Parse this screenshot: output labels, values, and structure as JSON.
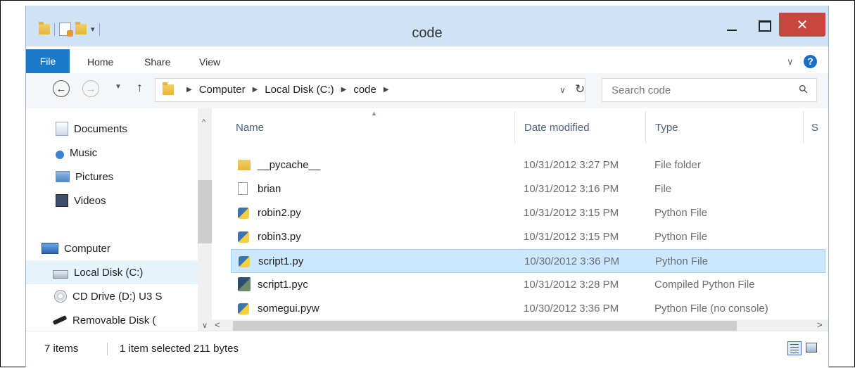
{
  "window": {
    "title": "code",
    "close_glyph": "✕"
  },
  "ribbon": {
    "file_label": "File",
    "tabs": [
      "Home",
      "Share",
      "View"
    ]
  },
  "address": {
    "crumbs": [
      "Computer",
      "Local Disk (C:)",
      "code"
    ],
    "search_placeholder": "Search code"
  },
  "nav": {
    "items": [
      {
        "label": "Documents",
        "icon": "documents-icon"
      },
      {
        "label": "Music",
        "icon": "music-icon"
      },
      {
        "label": "Pictures",
        "icon": "pictures-icon"
      },
      {
        "label": "Videos",
        "icon": "videos-icon"
      },
      {
        "label": "Computer",
        "icon": "computer-icon"
      },
      {
        "label": "Local Disk (C:)",
        "icon": "disk-icon",
        "selected": true
      },
      {
        "label": "CD Drive (D:) U3 S",
        "icon": "cd-drive-icon"
      },
      {
        "label": "Removable Disk (",
        "icon": "usb-icon"
      }
    ]
  },
  "list": {
    "columns": [
      "Name",
      "Date modified",
      "Type",
      "S"
    ],
    "rows": [
      {
        "name": "__pycache__",
        "date": "10/31/2012 3:27 PM",
        "type": "File folder",
        "icon": "folder-icon"
      },
      {
        "name": "brian",
        "date": "10/31/2012 3:16 PM",
        "type": "File",
        "icon": "file-icon"
      },
      {
        "name": "robin2.py",
        "date": "10/31/2012 3:15 PM",
        "type": "Python File",
        "icon": "python-file-icon"
      },
      {
        "name": "robin3.py",
        "date": "10/31/2012 3:15 PM",
        "type": "Python File",
        "icon": "python-file-icon"
      },
      {
        "name": "script1.py",
        "date": "10/30/2012 3:36 PM",
        "type": "Python File",
        "icon": "python-file-icon",
        "selected": true
      },
      {
        "name": "script1.pyc",
        "date": "10/31/2012 3:28 PM",
        "type": "Compiled Python File",
        "icon": "compiled-python-icon"
      },
      {
        "name": "somegui.pyw",
        "date": "10/30/2012 3:36 PM",
        "type": "Python File (no console)",
        "icon": "python-file-icon"
      }
    ]
  },
  "status": {
    "item_count": "7 items",
    "selection": "1 item selected 211 bytes"
  }
}
